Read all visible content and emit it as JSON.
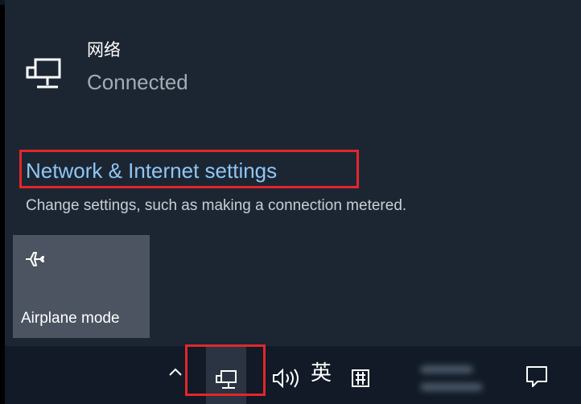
{
  "network": {
    "name": "网络",
    "status": "Connected"
  },
  "settings": {
    "link_label": "Network & Internet settings",
    "description": "Change settings, such as making a connection metered."
  },
  "quick_actions": [
    {
      "label": "Airplane mode",
      "icon": "airplane-icon"
    }
  ],
  "taskbar": {
    "ime_language": "英",
    "ime_mode_icon": "pinyin-icon",
    "icons": [
      "chevron-up-icon",
      "network-icon",
      "volume-icon",
      "pinyin-icon",
      "action-center-icon"
    ]
  },
  "colors": {
    "flyout_bg": "#1c2633",
    "link": "#8fc6f4",
    "highlight_border": "#e3262b",
    "tile_bg": "#4b5460"
  }
}
